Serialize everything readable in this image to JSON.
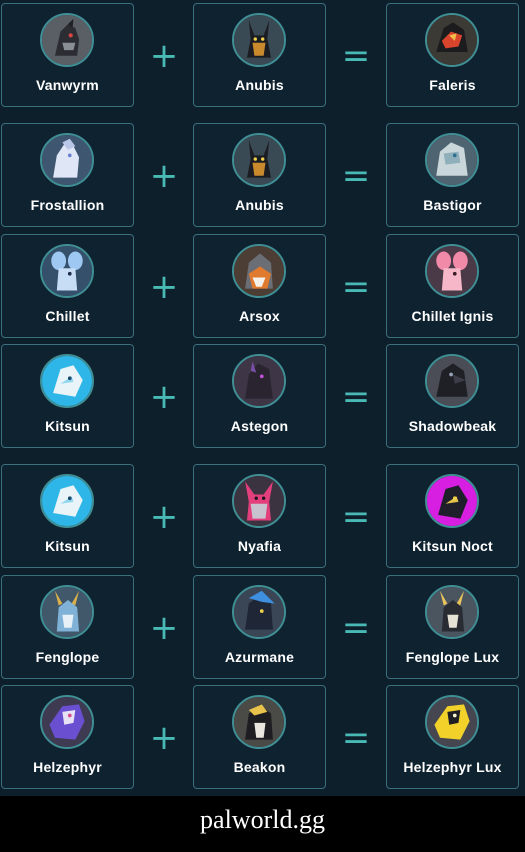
{
  "rows": [
    {
      "parent1": "Vanwyrm",
      "parent2": "Anubis",
      "child": "Faleris",
      "plus": "+",
      "equals": "="
    },
    {
      "parent1": "Frostallion",
      "parent2": "Anubis",
      "child": "Bastigor",
      "plus": "+",
      "equals": "="
    },
    {
      "parent1": "Chillet",
      "parent2": "Arsox",
      "child": "Chillet Ignis",
      "plus": "+",
      "equals": "="
    },
    {
      "parent1": "Kitsun",
      "parent2": "Astegon",
      "child": "Shadowbeak",
      "plus": "+",
      "equals": "="
    },
    {
      "parent1": "Kitsun",
      "parent2": "Nyafia",
      "child": "Kitsun Noct",
      "plus": "+",
      "equals": "="
    },
    {
      "parent1": "Fenglope",
      "parent2": "Azurmane",
      "child": "Fenglope Lux",
      "plus": "+",
      "equals": "="
    },
    {
      "parent1": "Helzephyr",
      "parent2": "Beakon",
      "child": "Helzephyr Lux",
      "plus": "+",
      "equals": "="
    }
  ],
  "watermark": "palworld.gg",
  "colors": {
    "background": "#0e1f2c",
    "card_border": "#3a6f7c",
    "avatar_ring": "#3f8f95",
    "operator": "#49b9b6",
    "footer": "#000000"
  }
}
